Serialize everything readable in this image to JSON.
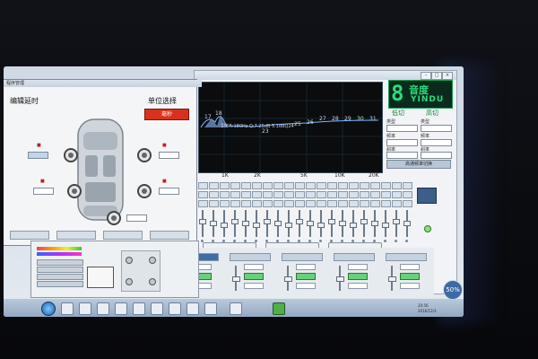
{
  "delay_window": {
    "title": "程序管理",
    "heading_left": "编辑延时",
    "heading_right": "单位选择",
    "unit_button": "毫秒"
  },
  "eq_graph": {
    "readout": "CR:180Hz Q:7.25dB 5.1dBQ24",
    "band_numbers": [
      "17",
      "18",
      "19",
      "23",
      "25",
      "26",
      "27",
      "28",
      "29",
      "30",
      "31"
    ],
    "freq_labels": [
      "1K",
      "2K",
      "5K",
      "10K",
      "20K"
    ]
  },
  "brand": {
    "number": "8",
    "cn": "音度",
    "en": "YINDU"
  },
  "filters": {
    "low_cut": "低切",
    "high_cut": "高切",
    "type_label": "类型",
    "freq_label": "频率",
    "slope_label": "斜率",
    "apply_button": "高通频率切换"
  },
  "taskbar": {
    "tray_time": "20:56",
    "tray_date": "2016/12/3"
  },
  "round_button": "50%"
}
